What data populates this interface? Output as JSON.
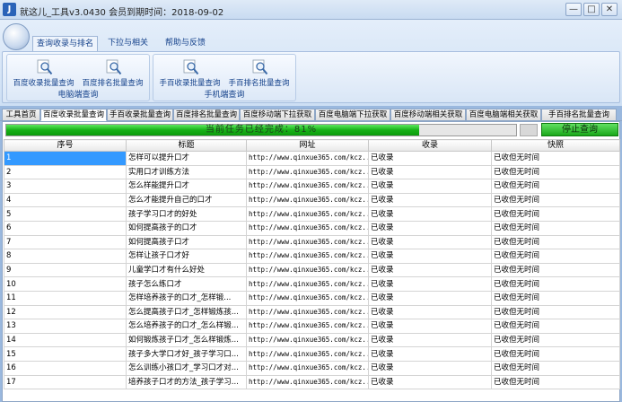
{
  "window": {
    "title": "就这儿_工具v3.0430    会员到期时间：2018-09-02",
    "controls": {
      "minimize": "—",
      "maximize": "□",
      "close": "✕"
    }
  },
  "ribbon": {
    "tabs": [
      "查询收录与排名",
      "下拉与相关",
      "帮助与反馈"
    ],
    "active_tab": 0,
    "groups": [
      {
        "label": "电脑端查询",
        "buttons": [
          {
            "label": "百度收录批量查询",
            "icon": "search-icon"
          },
          {
            "label": "百度排名批量查询",
            "icon": "search-icon"
          }
        ]
      },
      {
        "label": "手机端查询",
        "buttons": [
          {
            "label": "手百收录批量查询",
            "icon": "search-icon"
          },
          {
            "label": "手百排名批量查询",
            "icon": "search-icon"
          }
        ]
      }
    ]
  },
  "doc_tabs": [
    "工具首页",
    "百度收录批量查询",
    "手百收录批量查询",
    "百度排名批量查询",
    "百度移动端下拉获取",
    "百度电脑端下拉获取",
    "百度移动端相关获取",
    "百度电脑端相关获取",
    "手百排名批量查询"
  ],
  "active_doc_tab": 1,
  "task": {
    "progress_text": "当前任务已经完成：81%",
    "progress_percent": 81,
    "stop_label": "停止查询"
  },
  "table": {
    "columns": [
      "序号",
      "标题",
      "网址",
      "收录",
      "快照"
    ],
    "rows": [
      {
        "idx": "1",
        "title": "怎样可以提升口才",
        "url": "http://www.qinxue365.com/kcz...",
        "indexed": "已收录",
        "snapshot": "已收但无时间"
      },
      {
        "idx": "2",
        "title": "实用口才训练方法",
        "url": "http://www.qinxue365.com/kcz...",
        "indexed": "已收录",
        "snapshot": "已收但无时间"
      },
      {
        "idx": "3",
        "title": "怎么样能提升口才",
        "url": "http://www.qinxue365.com/kcz...",
        "indexed": "已收录",
        "snapshot": "已收但无时间"
      },
      {
        "idx": "4",
        "title": "怎么才能提升自己的口才",
        "url": "http://www.qinxue365.com/kcz...",
        "indexed": "已收录",
        "snapshot": "已收但无时间"
      },
      {
        "idx": "5",
        "title": "孩子学习口才的好处",
        "url": "http://www.qinxue365.com/kcz...",
        "indexed": "已收录",
        "snapshot": "已收但无时间"
      },
      {
        "idx": "6",
        "title": "如何提高孩子的口才",
        "url": "http://www.qinxue365.com/kcz...",
        "indexed": "已收录",
        "snapshot": "已收但无时间"
      },
      {
        "idx": "7",
        "title": "如何提高孩子口才",
        "url": "http://www.qinxue365.com/kcz...",
        "indexed": "已收录",
        "snapshot": "已收但无时间"
      },
      {
        "idx": "8",
        "title": "怎样让孩子口才好",
        "url": "http://www.qinxue365.com/kcz...",
        "indexed": "已收录",
        "snapshot": "已收但无时间"
      },
      {
        "idx": "9",
        "title": "儿童学口才有什么好处",
        "url": "http://www.qinxue365.com/kcz...",
        "indexed": "已收录",
        "snapshot": "已收但无时间"
      },
      {
        "idx": "10",
        "title": "孩子怎么练口才",
        "url": "http://www.qinxue365.com/kcz...",
        "indexed": "已收录",
        "snapshot": "已收但无时间"
      },
      {
        "idx": "11",
        "title": "怎样培养孩子的口才_怎样锻...",
        "url": "http://www.qinxue365.com/kcz...",
        "indexed": "已收录",
        "snapshot": "已收但无时间"
      },
      {
        "idx": "12",
        "title": "怎么提高孩子口才_怎样锻炼孩...",
        "url": "http://www.qinxue365.com/kcz...",
        "indexed": "已收录",
        "snapshot": "已收但无时间"
      },
      {
        "idx": "13",
        "title": "怎么培养孩子的口才_怎么样锻...",
        "url": "http://www.qinxue365.com/kcz...",
        "indexed": "已收录",
        "snapshot": "已收但无时间"
      },
      {
        "idx": "14",
        "title": "如何锻炼孩子口才_怎么样锻炼...",
        "url": "http://www.qinxue365.com/kcz...",
        "indexed": "已收录",
        "snapshot": "已收但无时间"
      },
      {
        "idx": "15",
        "title": "孩子多大学口才好_孩子学习口...",
        "url": "http://www.qinxue365.com/kcz...",
        "indexed": "已收录",
        "snapshot": "已收但无时间"
      },
      {
        "idx": "16",
        "title": "怎么训练小孩口才_学习口才对...",
        "url": "http://www.qinxue365.com/kcz...",
        "indexed": "已收录",
        "snapshot": "已收但无时间"
      },
      {
        "idx": "17",
        "title": "培养孩子口才的方法_孩子学习...",
        "url": "http://www.qinxue365.com/kcz...",
        "indexed": "已收录",
        "snapshot": "已收但无时间"
      }
    ]
  }
}
